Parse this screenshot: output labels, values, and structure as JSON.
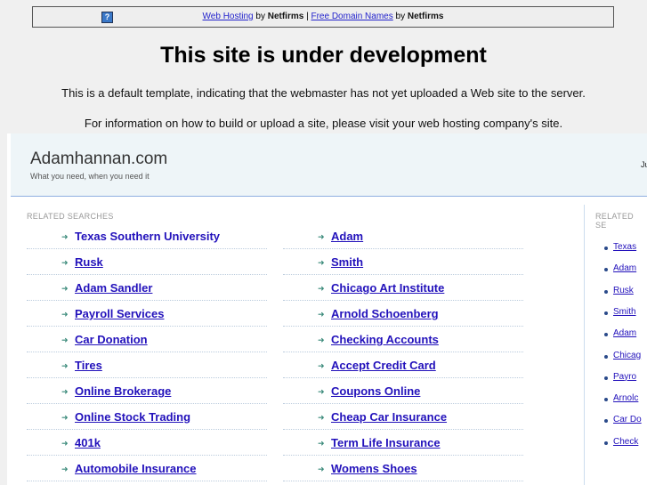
{
  "topbar": {
    "link1": "Web Hosting",
    "by1": "by",
    "brand1": "Netfirms",
    "sep": "|",
    "link2": "Free Domain Names",
    "by2": "by",
    "brand2": "Netfirms",
    "icon": "question-icon"
  },
  "title": "This site is under development",
  "para1": "This is a default template, indicating that the webmaster has not yet uploaded a Web site to the server.",
  "para2": "For information on how to build or upload a site, please visit your web hosting company's site.",
  "site": {
    "name": "Adamhannan.com",
    "tagline": "What you need, when you need it",
    "right_text": "Ju"
  },
  "related_label": "RELATED SEARCHES",
  "right_label": "RELATED SE",
  "left_col": [
    "Texas Southern University",
    "Rusk",
    "Adam Sandler",
    "Payroll Services",
    "Car Donation",
    "Tires",
    "Online Brokerage",
    "Online Stock Trading",
    "401k",
    "Automobile Insurance"
  ],
  "mid_col": [
    "Adam",
    "Smith",
    "Chicago Art Institute",
    "Arnold Schoenberg",
    "Checking Accounts",
    "Accept Credit Card",
    "Coupons Online",
    "Cheap Car Insurance",
    "Term Life Insurance",
    "Womens Shoes"
  ],
  "right_col": [
    "Texas",
    "Adam",
    "Rusk",
    "Smith",
    "Adam",
    "Chicag",
    "Payro",
    "Arnolc",
    "Car Do",
    "Check"
  ]
}
